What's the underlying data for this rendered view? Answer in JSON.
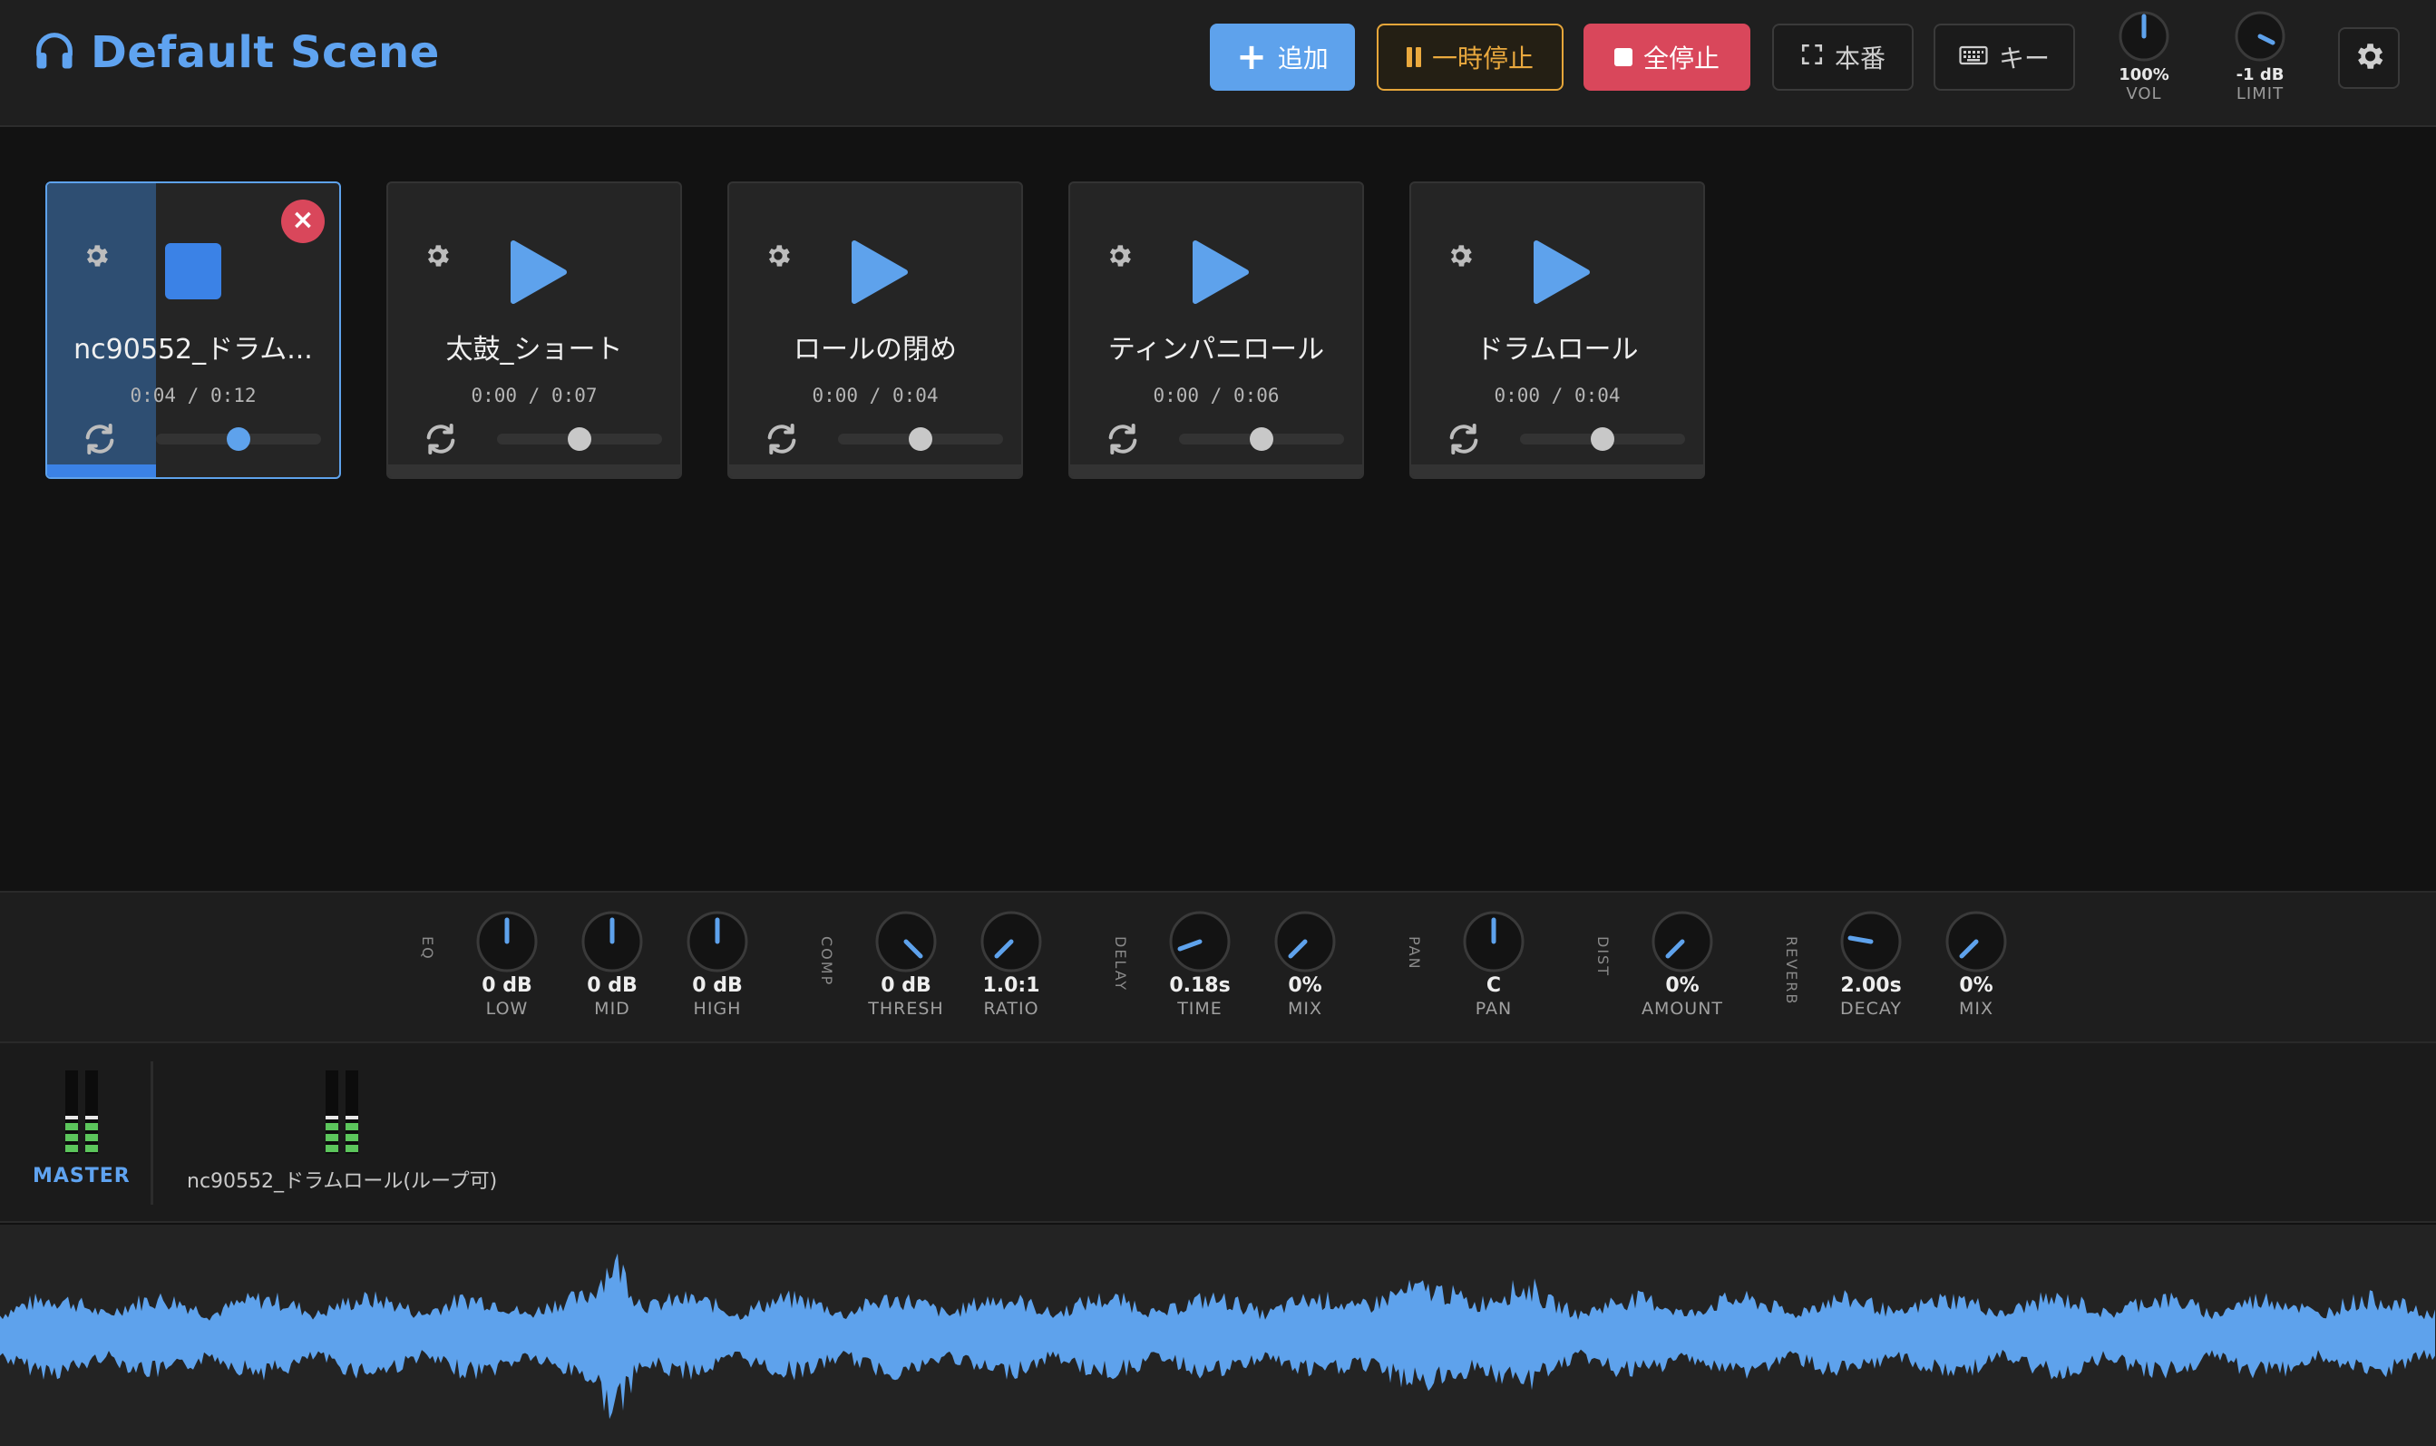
{
  "app": {
    "title": "Default Scene",
    "accent": "#5ea2ec"
  },
  "toolbar": {
    "add_label": "追加",
    "pause_label": "一時停止",
    "stop_all_label": "全停止",
    "live_label": "本番",
    "keys_label": "キー",
    "volume": {
      "value": "100%",
      "label": "VOL",
      "level": 1.0
    },
    "limiter": {
      "value": "-1 dB",
      "label": "LIMIT"
    }
  },
  "pads": [
    {
      "title": "nc90552_ドラム...",
      "time": "0:04 / 0:12",
      "playing": true,
      "progress": 0.33,
      "volume": 0.5
    },
    {
      "title": "太鼓_ショート",
      "time": "0:00 / 0:07",
      "playing": false,
      "progress": 0,
      "volume": 0.5
    },
    {
      "title": "ロールの閉め",
      "time": "0:00 / 0:04",
      "playing": false,
      "progress": 0,
      "volume": 0.5
    },
    {
      "title": "ティンパニロール",
      "time": "0:00 / 0:06",
      "playing": false,
      "progress": 0,
      "volume": 0.5
    },
    {
      "title": "ドラムロール",
      "time": "0:00 / 0:04",
      "playing": false,
      "progress": 0,
      "volume": 0.5
    }
  ],
  "effects": {
    "eq": {
      "label": "EQ",
      "low": {
        "value": "0 dB",
        "label": "LOW"
      },
      "mid": {
        "value": "0 dB",
        "label": "MID"
      },
      "high": {
        "value": "0 dB",
        "label": "HIGH"
      }
    },
    "comp": {
      "label": "COMP",
      "thresh": {
        "value": "0 dB",
        "label": "THRESH"
      },
      "ratio": {
        "value": "1.0:1",
        "label": "RATIO"
      }
    },
    "delay": {
      "label": "DELAY",
      "time": {
        "value": "0.18s",
        "label": "TIME"
      },
      "mix": {
        "value": "0%",
        "label": "MIX"
      }
    },
    "pan": {
      "label": "PAN",
      "pan": {
        "value": "C",
        "label": "PAN"
      }
    },
    "dist": {
      "label": "DIST",
      "amount": {
        "value": "0%",
        "label": "AMOUNT"
      }
    },
    "reverb": {
      "label": "REVERB",
      "decay": {
        "value": "2.00s",
        "label": "DECAY"
      },
      "mix": {
        "value": "0%",
        "label": "MIX"
      }
    }
  },
  "mixer": {
    "master_label": "MASTER",
    "channels": [
      {
        "label": "nc90552_ドラムロール(ループ可)"
      }
    ]
  }
}
